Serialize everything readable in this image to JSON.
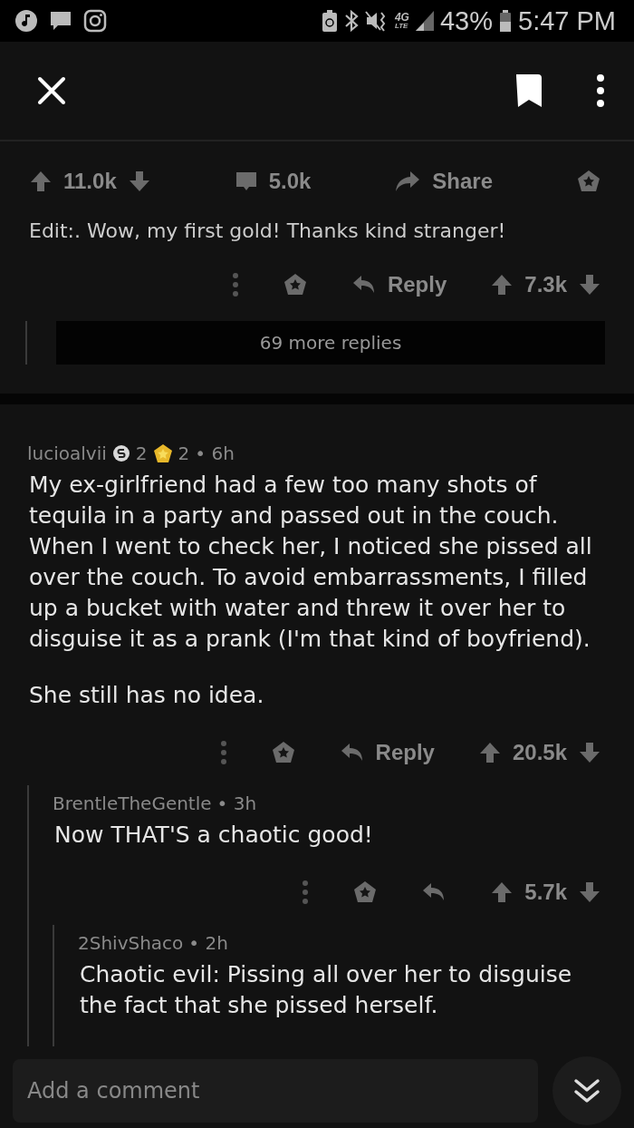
{
  "status_bar": {
    "network": "4G",
    "network_sub": "LTE",
    "battery": "43%",
    "time": "5:47 PM"
  },
  "post_actions": {
    "upvotes": "11.0k",
    "comments": "5.0k",
    "share": "Share"
  },
  "previous_comment": {
    "body_tail": "Edit:. Wow, my first gold! Thanks kind stranger!",
    "reply_label": "Reply",
    "score": "7.3k",
    "more_replies": "69 more replies"
  },
  "comments": [
    {
      "author": "lucioalvii",
      "awards": [
        {
          "kind": "silver",
          "count": "2"
        },
        {
          "kind": "gold",
          "count": "2"
        }
      ],
      "time": "• 6h",
      "paragraphs": [
        "My ex-girlfriend had a few too many shots of tequila in a party and passed out in the couch. When I went to check her, I noticed she pissed all over the couch. To avoid embarrassments, I filled up a bucket with water and threw it over her to disguise it as a prank (I'm that kind of boyfriend).",
        "She still has no idea."
      ],
      "reply_label": "Reply",
      "score": "20.5k",
      "children": [
        {
          "author": "BrentleTheGentle",
          "time": "• 3h",
          "paragraphs": [
            "Now THAT'S a chaotic good!"
          ],
          "score": "5.7k",
          "children": [
            {
              "author": "2ShivShaco",
              "time": "• 2h",
              "paragraphs": [
                "Chaotic evil: Pissing all over her to disguise the fact that she pissed herself."
              ]
            }
          ]
        }
      ]
    }
  ],
  "composer": {
    "placeholder": "Add a comment"
  }
}
